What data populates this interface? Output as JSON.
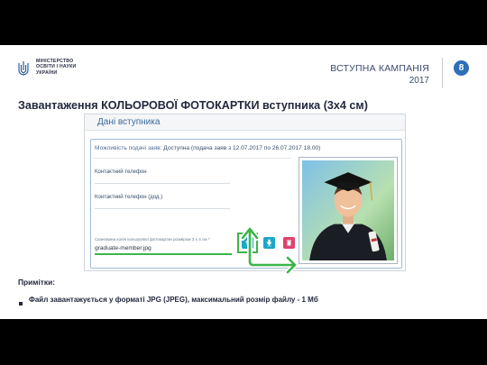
{
  "header": {
    "ministry_lines": [
      "МІНІСТЕРСТВО",
      "ОСВІТИ І НАУКИ",
      "УКРАЇНИ"
    ],
    "campaign": "ВСТУПНА КАМПАНІЯ",
    "year": "2017",
    "page_number": "8",
    "accent_color": "#2e6fb8"
  },
  "title": "Завантаження КОЛЬОРОВОЇ ФОТОКАРТКИ вступника (3х4 см)",
  "panel": {
    "title": "Дані вступника",
    "availability_label": "Можливість подачі заяв:",
    "availability_value": "Доступна (подача заяв з 12.07.2017 по 26.07.2017 18.00)",
    "fields": [
      {
        "label": "Контактний телефон"
      },
      {
        "label": "Контактний телефон (дод.)"
      }
    ],
    "photo_label": "Сканована копія кольорової фотокартки розміром 3 x 4 см *",
    "file_name": "graduate-member.jpg",
    "buttons": {
      "upload_icon": "upload-icon",
      "download_icon": "download-icon",
      "delete_icon": "trash-icon"
    },
    "highlight_color": "#3cb54a"
  },
  "notes": {
    "label": "Примітки:",
    "items": [
      "Файл завантажується у форматі JPG (JPEG), максимальний розмір файлу - 1 Мб"
    ]
  }
}
